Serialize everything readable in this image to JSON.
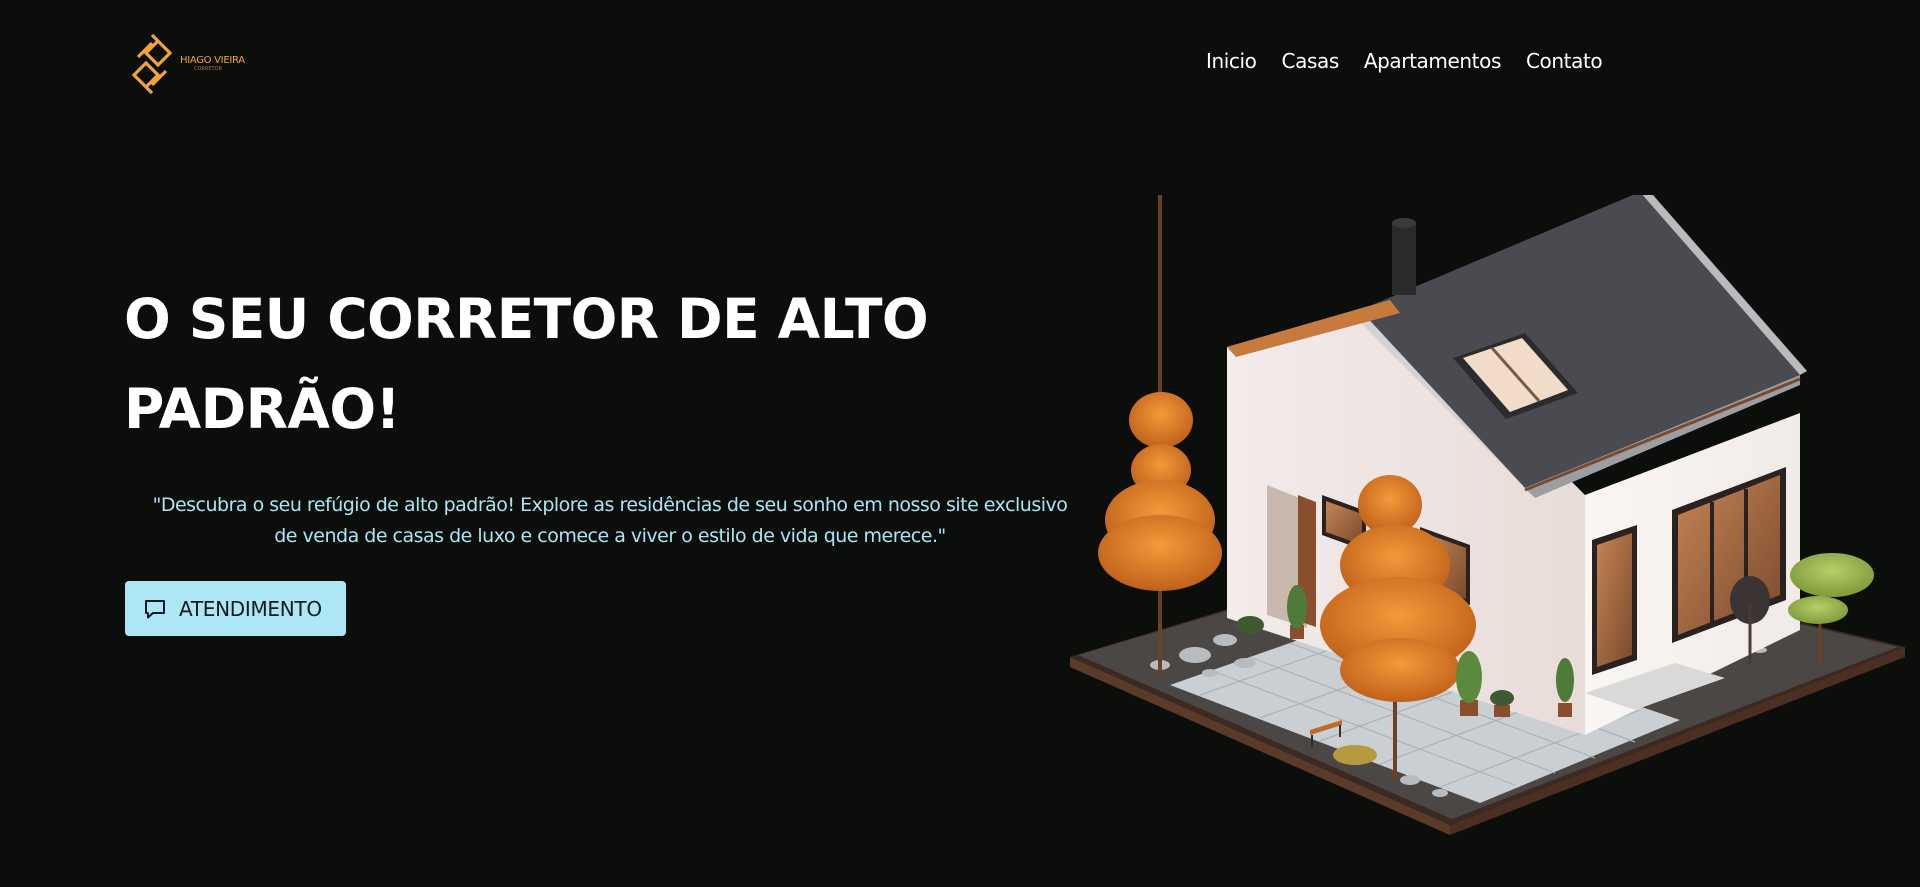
{
  "brand": {
    "name": "HIAGO VIEIRA",
    "subtitle": "CORRETOR",
    "logo_color": "#f0a53a"
  },
  "nav": {
    "items": [
      {
        "label": "Inicio"
      },
      {
        "label": "Casas"
      },
      {
        "label": "Apartamentos"
      },
      {
        "label": "Contato"
      }
    ]
  },
  "hero": {
    "title_line1": "O SEU CORRETOR DE ALTO",
    "title_line2": "PADRÃO!",
    "description": "\"Descubra o seu refúgio de alto padrão! Explore as residências de seu sonho em nosso site exclusivo de venda de casas de luxo e comece a viver o estilo de vida que merece.\"",
    "cta_label": "ATENDIMENTO",
    "cta_icon": "chat-bubble-icon",
    "accent_color": "#ade6f4",
    "text_accent_color": "#a8e6f5"
  },
  "illustration": {
    "icon": "isometric-house-illustration"
  }
}
